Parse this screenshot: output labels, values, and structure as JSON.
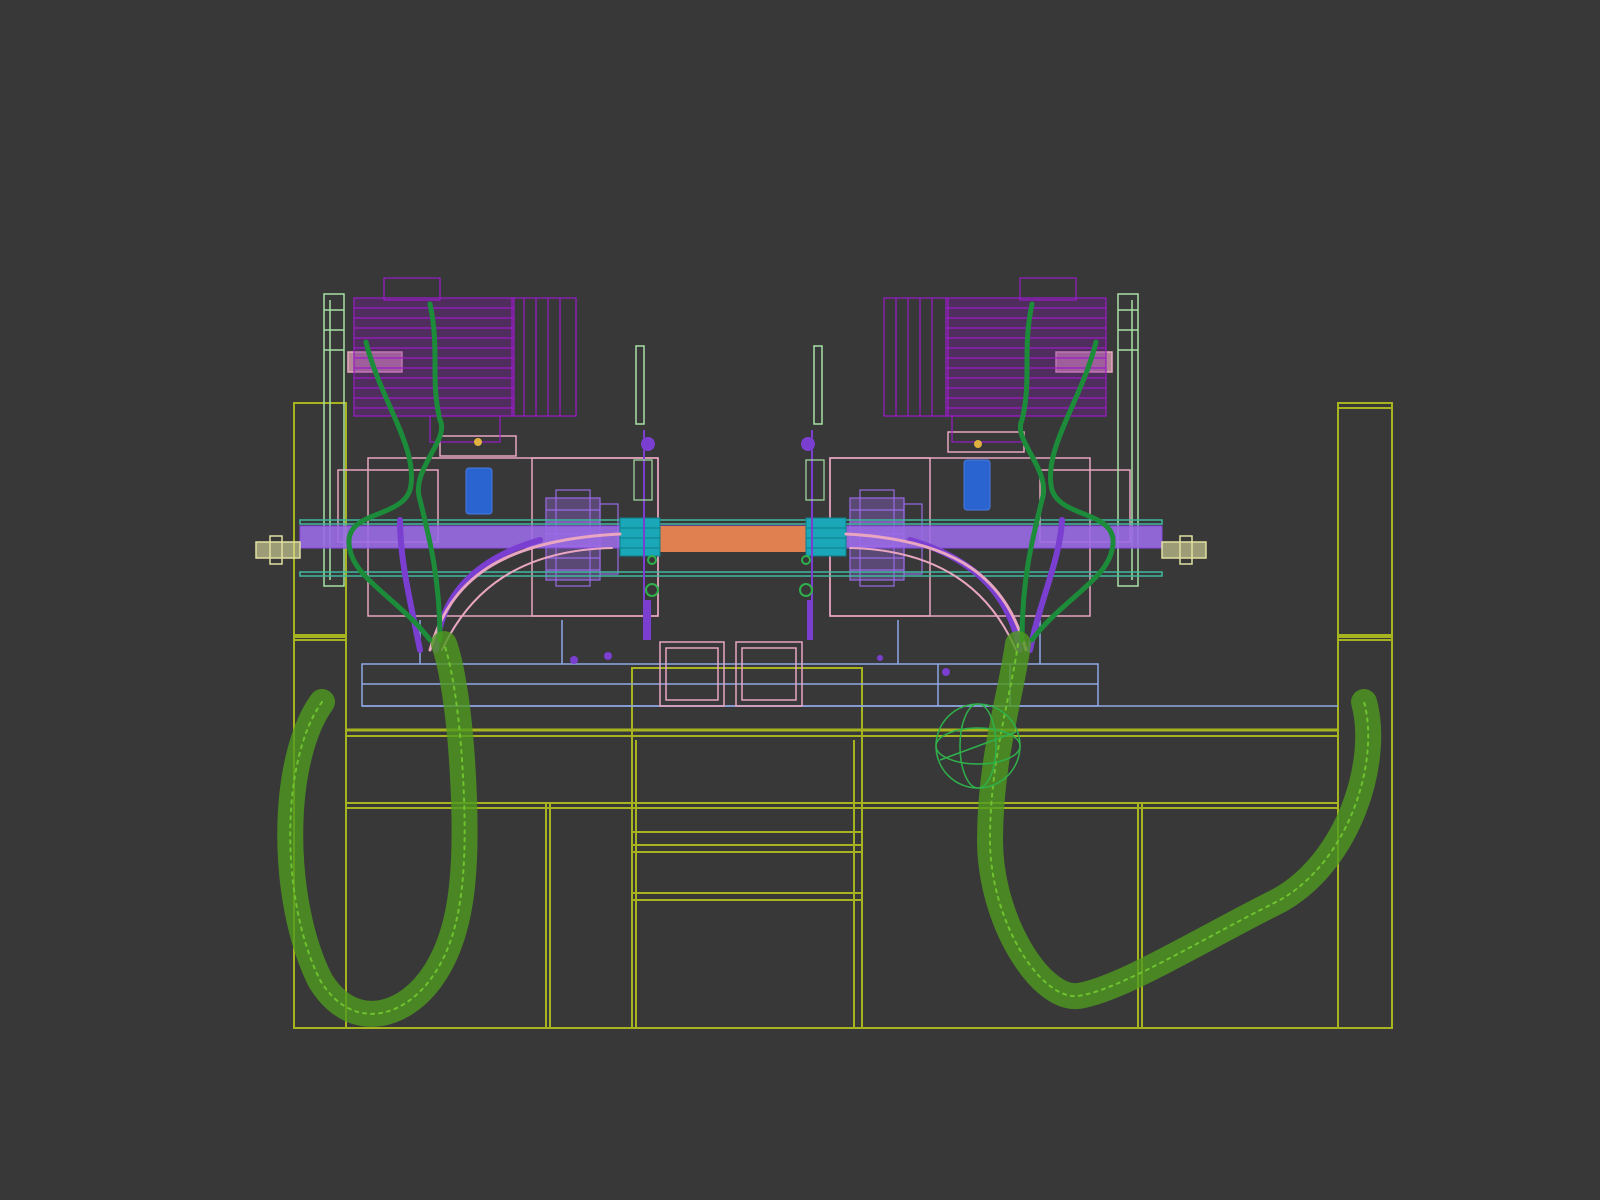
{
  "viewport": {
    "background_color": "#383838",
    "view_mode": "wireframe",
    "wire_colors": {
      "frame": "#a8b41f",
      "frame_dark": "#8c9a18",
      "hose": "#4f9a1f",
      "cable_green": "#1c8b3a",
      "cable_purple": "#7a3ed0",
      "motor": "#9a1cc9",
      "pump": "#9a6ae6",
      "rail": "#9a6ae6",
      "shaft": "#e08050",
      "plate": "#e8a6c0",
      "base": "#8fa7e6",
      "cyan_block": "#1aa7b8",
      "light_green": "#a6e0a6",
      "blue_cup": "#2a64d0",
      "teal": "#3fb8a0",
      "end_fitting": "#e0e0a0"
    }
  }
}
